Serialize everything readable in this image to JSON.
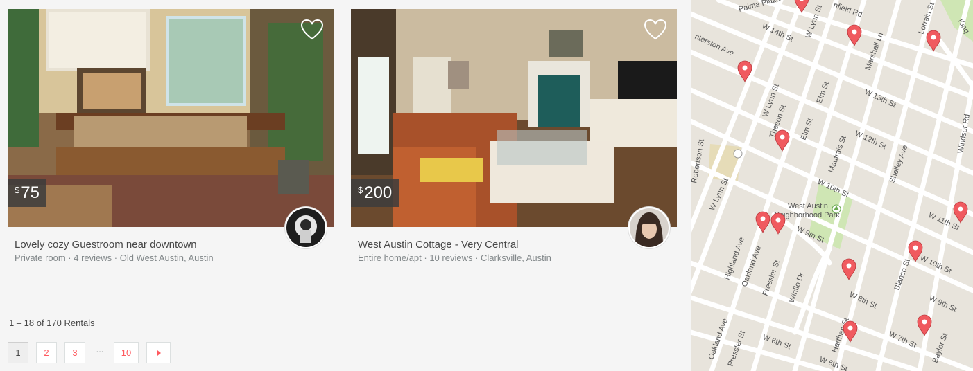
{
  "listings": [
    {
      "price_currency": "$",
      "price_amount": "75",
      "title": "Lovely cozy Guestroom near downtown",
      "subtitle": "Private room · 4 reviews · Old West Austin, Austin"
    },
    {
      "price_currency": "$",
      "price_amount": "200",
      "title": "West Austin Cottage - Very Central",
      "subtitle": "Entire home/apt · 10 reviews · Clarksville, Austin"
    }
  ],
  "results_count": "1 – 18 of 170 Rentals",
  "pagination": {
    "pages": [
      "1",
      "2",
      "3"
    ],
    "ellipsis": "...",
    "last_page": "10",
    "active_page": "1",
    "next_icon": "caret-right-icon"
  },
  "map": {
    "street_labels": {
      "palma_plaza": "Palma Plaza",
      "enfield_rd": "nfield Rd",
      "w14": "W 14th St",
      "interston": "nterston Ave",
      "w_lynn_top": "W Lynn St",
      "marshall": "Marshall Ln",
      "lorrain": "Lorrain St",
      "king": "King",
      "w13": "W 13th St",
      "elm1": "Elm St",
      "w_lynn2": "W Lynn St",
      "windsor": "Windsor Rd",
      "robertson": "Robertson St",
      "elm2": "Elm St",
      "theson": "Theson St",
      "w12": "W 12th St",
      "maufrais": "Maufrais St",
      "shelley": "Shelley Ave",
      "w10": "W 10th St",
      "w_lynn3": "W Lynn St",
      "park1": "West Austin",
      "park2": "Neighborhood Park",
      "w11": "W 11th St",
      "w9a": "W 9th St",
      "highland": "Highland Ave",
      "oakland1": "Oakland Ave",
      "pressler1": "Pressler St",
      "winflo": "Winflo Dr",
      "w10b": "W 10th St",
      "blanco": "Blanco St",
      "w8": "W 8th St",
      "w9b": "W 9th St",
      "oakland2": "Oakland Ave",
      "pressler2": "Pressler St",
      "harthan": "Harthan St",
      "w6a": "W 6th St",
      "w7": "W 7th St",
      "baylor": "Baylor St",
      "w6b": "W 6th St"
    },
    "colors": {
      "pin": "#f05a5f",
      "park": "#cfe6b4",
      "road": "#ffffff",
      "land": "#e8e4dc"
    }
  },
  "colors": {
    "accent": "#ff5a5f",
    "text": "#484848",
    "muted": "#82888a"
  }
}
